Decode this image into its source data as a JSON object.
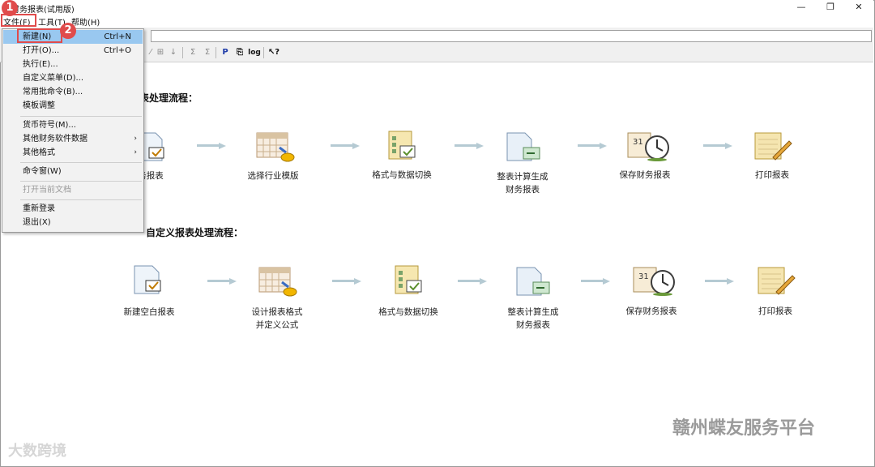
{
  "window": {
    "title": "财务报表(试用版)",
    "controls": [
      "—",
      "❐",
      "✕"
    ]
  },
  "menubar": {
    "items": [
      "文件(F)",
      "工具(T)",
      "帮助(H)"
    ]
  },
  "toolbar": {
    "buttons": [
      "⁄",
      "⊞",
      "↓",
      "Σ",
      "Σ",
      "P",
      "⎘",
      "log",
      "↖?"
    ]
  },
  "file_menu": {
    "items": [
      {
        "label": "新建(N)",
        "shortcut": "Ctrl+N"
      },
      {
        "label": "打开(O)...",
        "shortcut": "Ctrl+O"
      },
      {
        "label": "执行(E)..."
      },
      {
        "label": "自定义菜单(D)..."
      },
      {
        "label": "常用批命令(B)..."
      },
      {
        "label": "模板调整"
      },
      {
        "label": "货币符号(M)..."
      },
      {
        "label": "其他财务软件数据",
        "submenu": "›"
      },
      {
        "label": "其他格式",
        "submenu": "›"
      },
      {
        "label": "命令窗(W)"
      },
      {
        "label": "打开当前文档",
        "disabled": true
      },
      {
        "label": "重新登录"
      },
      {
        "label": "退出(X)"
      }
    ]
  },
  "annotations": [
    "1",
    "2"
  ],
  "flow1": {
    "title_visible": "表处理流程：",
    "steps": [
      {
        "label": "务报表",
        "icon": "new-report-icon"
      },
      {
        "label": "选择行业模版",
        "icon": "template-calendar-icon"
      },
      {
        "label": "格式与数据切换",
        "icon": "checklist-icon"
      },
      {
        "label1": "整表计算生成",
        "label2": "财务报表",
        "icon": "generate-report-icon"
      },
      {
        "label": "保存财务报表",
        "icon": "calendar-clock-icon"
      },
      {
        "label": "打印报表",
        "icon": "print-notepad-icon"
      }
    ]
  },
  "flow2": {
    "title_visible": "自定义报表处理流程：",
    "steps": [
      {
        "label": "新建空白报表",
        "icon": "new-report-icon"
      },
      {
        "label1": "设计报表格式",
        "label2": "并定义公式",
        "icon": "template-calendar-icon"
      },
      {
        "label": "格式与数据切换",
        "icon": "checklist-icon"
      },
      {
        "label1": "整表计算生成",
        "label2": "财务报表",
        "icon": "generate-report-icon"
      },
      {
        "label": "保存财务报表",
        "icon": "calendar-clock-icon"
      },
      {
        "label": "打印报表",
        "icon": "print-notepad-icon"
      }
    ]
  },
  "watermarks": {
    "left": "大数跨境",
    "right": "赣州蝶友服务平台"
  }
}
